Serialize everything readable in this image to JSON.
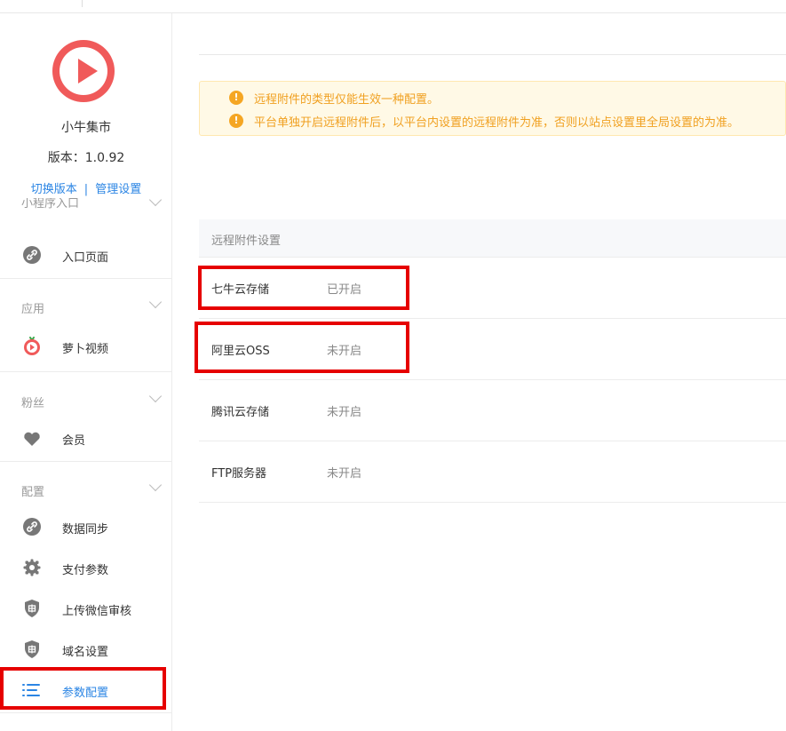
{
  "app": {
    "name": "小牛集市",
    "version": "版本：1.0.92",
    "switch_version": "切换版本",
    "link_separator": "|",
    "manage_settings": "管理设置",
    "brand_color": "#f05a5a"
  },
  "sidebar": {
    "partial_group_title": "小程序入口",
    "groups": [
      {
        "title": "应用",
        "items": [
          {
            "label": "萝卜视频",
            "icon": "radish-video-icon"
          }
        ]
      },
      {
        "title": "粉丝",
        "items": [
          {
            "label": "会员",
            "icon": "heart-icon"
          }
        ]
      },
      {
        "title": "配置",
        "items": [
          {
            "label": "数据同步",
            "icon": "link-icon"
          },
          {
            "label": "支付参数",
            "icon": "gear-icon"
          },
          {
            "label": "上传微信审核",
            "icon": "shield-icon"
          },
          {
            "label": "域名设置",
            "icon": "shield-icon"
          },
          {
            "label": "参数配置",
            "icon": "list-icon",
            "active": true
          }
        ]
      }
    ],
    "entry_item": {
      "label": "入口页面",
      "icon": "link-icon"
    },
    "active_color": "#2b85e4"
  },
  "main": {
    "alert": {
      "lines": [
        "远程附件的类型仅能生效一种配置。",
        "平台单独开启远程附件后，以平台内设置的远程附件为准，否则以站点设置里全局设置的为准。"
      ],
      "icon": "info-icon",
      "color": "#f0a020"
    },
    "settings": {
      "title": "远程附件设置",
      "rows": [
        {
          "name": "七牛云存储",
          "status": "已开启"
        },
        {
          "name": "阿里云OSS",
          "status": "未开启"
        },
        {
          "name": "腾讯云存储",
          "status": "未开启"
        },
        {
          "name": "FTP服务器",
          "status": "未开启"
        }
      ]
    }
  },
  "highlight_color": "#e60000"
}
